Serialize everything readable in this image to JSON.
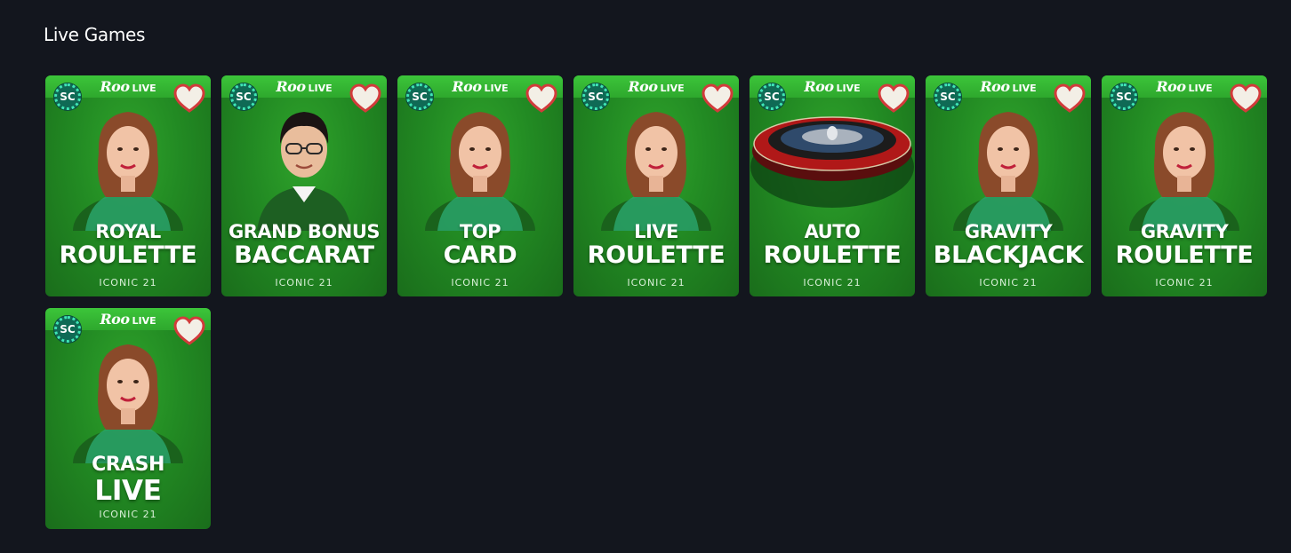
{
  "section": {
    "title": "Live Games"
  },
  "brand": {
    "roo": "Roo",
    "live": "LIVE",
    "sc": "SC"
  },
  "games": [
    {
      "line1": "ROYAL",
      "line2": "ROULETTE",
      "provider": "ICONIC 21",
      "art": "dealer-woman"
    },
    {
      "line1": "GRAND BONUS",
      "line2": "BACCARAT",
      "provider": "ICONIC 21",
      "art": "dealer-man"
    },
    {
      "line1": "TOP",
      "line2": "CARD",
      "provider": "ICONIC 21",
      "art": "dealer-woman"
    },
    {
      "line1": "LIVE",
      "line2": "ROULETTE",
      "provider": "ICONIC 21",
      "art": "dealer-woman"
    },
    {
      "line1": "AUTO",
      "line2": "ROULETTE",
      "provider": "ICONIC 21",
      "art": "roulette-wheel"
    },
    {
      "line1": "GRAVITY",
      "line2": "BLACKJACK",
      "provider": "ICONIC 21",
      "art": "dealer-woman"
    },
    {
      "line1": "GRAVITY",
      "line2": "ROULETTE",
      "provider": "ICONIC 21",
      "art": "dealer-woman"
    },
    {
      "line1": "CRASH",
      "line2": "LIVE",
      "provider": "ICONIC 21",
      "art": "dealer-woman"
    }
  ],
  "colors": {
    "page_bg": "#13161e",
    "card_green": "#228a23",
    "topbar_green": "#3cc53a",
    "heart_fill": "#f3efe6",
    "heart_stroke": "#d23b3b",
    "sc_teal": "#3fe6b6"
  }
}
